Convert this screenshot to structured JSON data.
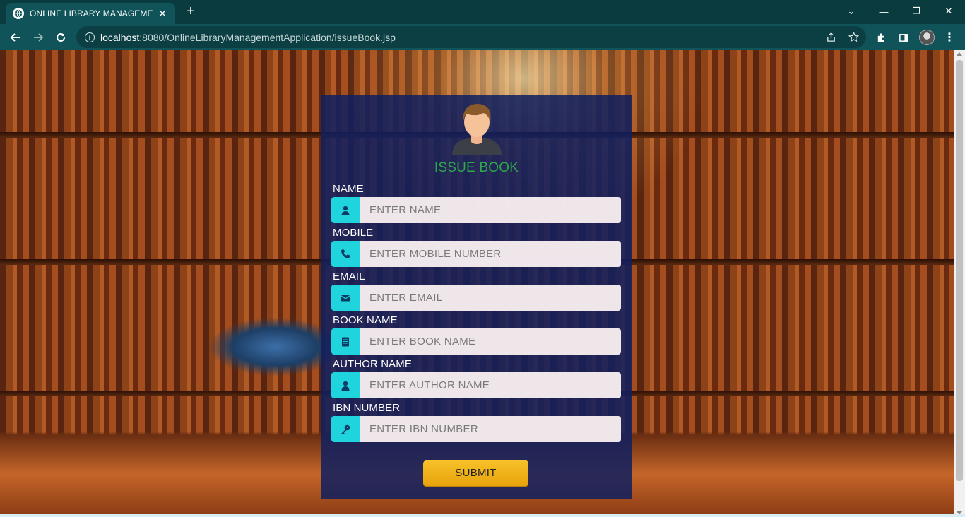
{
  "browser": {
    "tab_title": "ONLINE LIBRARY MANAGEMENT",
    "tab_close": "✕",
    "new_tab": "+",
    "url_host": "localhost",
    "url_path": ":8080/OnlineLibraryManagementApplication/issueBook.jsp",
    "window_controls": {
      "dropdown": "⌄",
      "minimize": "—",
      "restore": "❐",
      "close": "✕"
    }
  },
  "form": {
    "title": "ISSUE BOOK",
    "fields": [
      {
        "label": "NAME",
        "placeholder": "ENTER NAME",
        "icon": "user-icon"
      },
      {
        "label": "MOBILE",
        "placeholder": "ENTER MOBILE NUMBER",
        "icon": "phone-icon"
      },
      {
        "label": "EMAIL",
        "placeholder": "ENTER EMAIL",
        "icon": "envelope-icon"
      },
      {
        "label": "BOOK NAME",
        "placeholder": "ENTER BOOK NAME",
        "icon": "book-icon"
      },
      {
        "label": "AUTHOR NAME",
        "placeholder": "ENTER AUTHOR NAME",
        "icon": "user-icon"
      },
      {
        "label": "IBN NUMBER",
        "placeholder": "ENTER IBN NUMBER",
        "icon": "key-icon"
      }
    ],
    "submit_label": "SUBMIT"
  },
  "colors": {
    "title_green": "#2fa84a",
    "icon_cyan": "#1fd4dc",
    "card_navy": "#102060",
    "button_gold": "#f7c22a",
    "chrome_teal": "#10545a"
  }
}
